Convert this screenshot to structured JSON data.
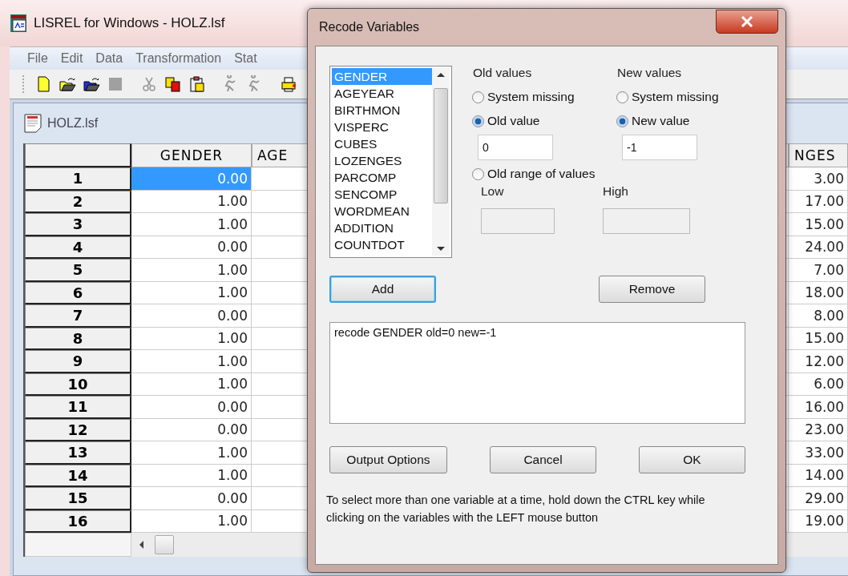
{
  "main_window": {
    "title": "LISREL for Windows - HOLZ.lsf",
    "menu": [
      "File",
      "Edit",
      "Data",
      "Transformation",
      "Stat"
    ],
    "toolbar": [
      {
        "kind": "new",
        "disabled": false
      },
      {
        "kind": "open",
        "disabled": false
      },
      {
        "kind": "open-blue",
        "disabled": false
      },
      {
        "kind": "save",
        "disabled": true
      },
      {
        "kind": "cut",
        "disabled": true
      },
      {
        "kind": "copy",
        "disabled": false
      },
      {
        "kind": "paste",
        "disabled": false
      },
      {
        "kind": "run",
        "disabled": true
      },
      {
        "kind": "run",
        "disabled": true
      },
      {
        "kind": "print",
        "disabled": false
      }
    ]
  },
  "data_window": {
    "title": "HOLZ.lsf",
    "columns": [
      "GENDER",
      "AGE",
      "NGES"
    ],
    "rows": [
      {
        "header": "1",
        "cells": [
          {
            "value": "0.00",
            "selected": true
          },
          {
            "value": "3.00",
            "selected": false
          }
        ]
      },
      {
        "header": "2",
        "cells": [
          {
            "value": "1.00",
            "selected": false
          },
          {
            "value": "17.00",
            "selected": false
          }
        ]
      },
      {
        "header": "3",
        "cells": [
          {
            "value": "1.00",
            "selected": false
          },
          {
            "value": "15.00",
            "selected": false
          }
        ]
      },
      {
        "header": "4",
        "cells": [
          {
            "value": "0.00",
            "selected": false
          },
          {
            "value": "24.00",
            "selected": false
          }
        ]
      },
      {
        "header": "5",
        "cells": [
          {
            "value": "1.00",
            "selected": false
          },
          {
            "value": "7.00",
            "selected": false
          }
        ]
      },
      {
        "header": "6",
        "cells": [
          {
            "value": "1.00",
            "selected": false
          },
          {
            "value": "18.00",
            "selected": false
          }
        ]
      },
      {
        "header": "7",
        "cells": [
          {
            "value": "0.00",
            "selected": false
          },
          {
            "value": "8.00",
            "selected": false
          }
        ]
      },
      {
        "header": "8",
        "cells": [
          {
            "value": "1.00",
            "selected": false
          },
          {
            "value": "15.00",
            "selected": false
          }
        ]
      },
      {
        "header": "9",
        "cells": [
          {
            "value": "1.00",
            "selected": false
          },
          {
            "value": "12.00",
            "selected": false
          }
        ]
      },
      {
        "header": "10",
        "cells": [
          {
            "value": "1.00",
            "selected": false
          },
          {
            "value": "6.00",
            "selected": false
          }
        ]
      },
      {
        "header": "11",
        "cells": [
          {
            "value": "0.00",
            "selected": false
          },
          {
            "value": "16.00",
            "selected": false
          }
        ]
      },
      {
        "header": "12",
        "cells": [
          {
            "value": "0.00",
            "selected": false
          },
          {
            "value": "23.00",
            "selected": false
          }
        ]
      },
      {
        "header": "13",
        "cells": [
          {
            "value": "1.00",
            "selected": false
          },
          {
            "value": "33.00",
            "selected": false
          }
        ]
      },
      {
        "header": "14",
        "cells": [
          {
            "value": "1.00",
            "selected": false
          },
          {
            "value": "14.00",
            "selected": false
          }
        ]
      },
      {
        "header": "15",
        "cells": [
          {
            "value": "0.00",
            "selected": false
          },
          {
            "value": "29.00",
            "selected": false
          }
        ]
      },
      {
        "header": "16",
        "cells": [
          {
            "value": "1.00",
            "selected": false
          },
          {
            "value": "19.00",
            "selected": false
          }
        ]
      }
    ]
  },
  "dialog": {
    "title": "Recode Variables",
    "variables": [
      {
        "name": "GENDER",
        "selected": true
      },
      {
        "name": "AGEYEAR",
        "selected": false
      },
      {
        "name": "BIRTHMON",
        "selected": false
      },
      {
        "name": "VISPERC",
        "selected": false
      },
      {
        "name": "CUBES",
        "selected": false
      },
      {
        "name": "LOZENGES",
        "selected": false
      },
      {
        "name": "PARCOMP",
        "selected": false
      },
      {
        "name": "SENCOMP",
        "selected": false
      },
      {
        "name": "WORDMEAN",
        "selected": false
      },
      {
        "name": "ADDITION",
        "selected": false
      },
      {
        "name": "COUNTDOT",
        "selected": false
      }
    ],
    "old_values": {
      "label": "Old values",
      "options": [
        {
          "label": "System missing",
          "selected": false
        },
        {
          "label": "Old value",
          "selected": true
        }
      ],
      "value": "0",
      "range_option": {
        "label": "Old range of values",
        "selected": false
      },
      "low": {
        "label": "Low",
        "disabled": true
      },
      "high": {
        "label": "High",
        "disabled": true
      }
    },
    "new_values": {
      "label": "New values",
      "options": [
        {
          "label": "System missing",
          "selected": false
        },
        {
          "label": "New value",
          "selected": true
        }
      ],
      "value": "-1"
    },
    "add_button": {
      "label": "Add",
      "focused": true
    },
    "remove_button": {
      "label": "Remove",
      "focused": false
    },
    "commands": "recode GENDER old=0 new=-1",
    "action_buttons": [
      "Output Options",
      "Cancel",
      "OK"
    ],
    "help": "To select more than one variable at a time, hold down the CTRL key while clicking on the variables with the LEFT mouse button"
  }
}
